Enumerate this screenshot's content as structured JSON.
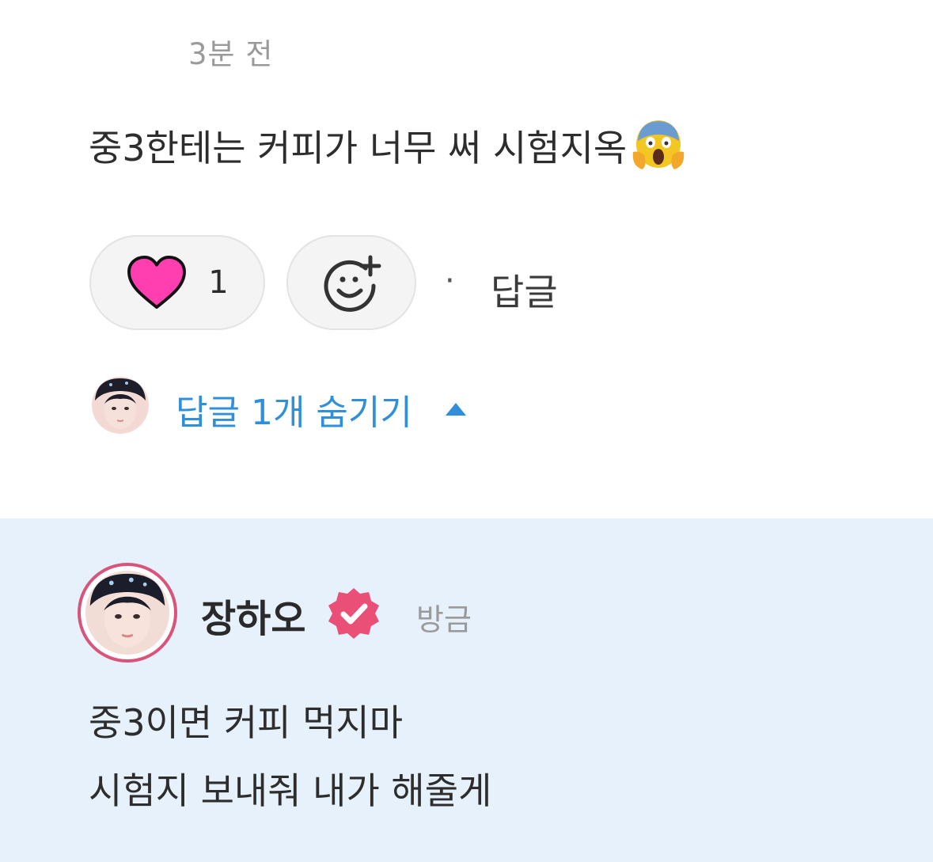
{
  "comment": {
    "timestamp": "3분 전",
    "text": "중3한테는 커피가 너무 써 시험지옥",
    "emoji": "face-screaming-in-fear"
  },
  "actions": {
    "like_count": "1",
    "separator": "·",
    "reply_label": "답글"
  },
  "replies_toggle": {
    "label": "답글 1개 숨기기"
  },
  "reply": {
    "author": "장하오",
    "time": "방금",
    "lines": [
      "중3이면 커피 먹지마",
      "시험지 보내줘 내가 해줄게"
    ]
  },
  "colors": {
    "heart": "#ff3fb0",
    "link_blue": "#2f8fd8",
    "reply_bg": "#e7f1fb",
    "verified_pink": "#ea4f78",
    "avatar_ring": "#d9547a"
  }
}
